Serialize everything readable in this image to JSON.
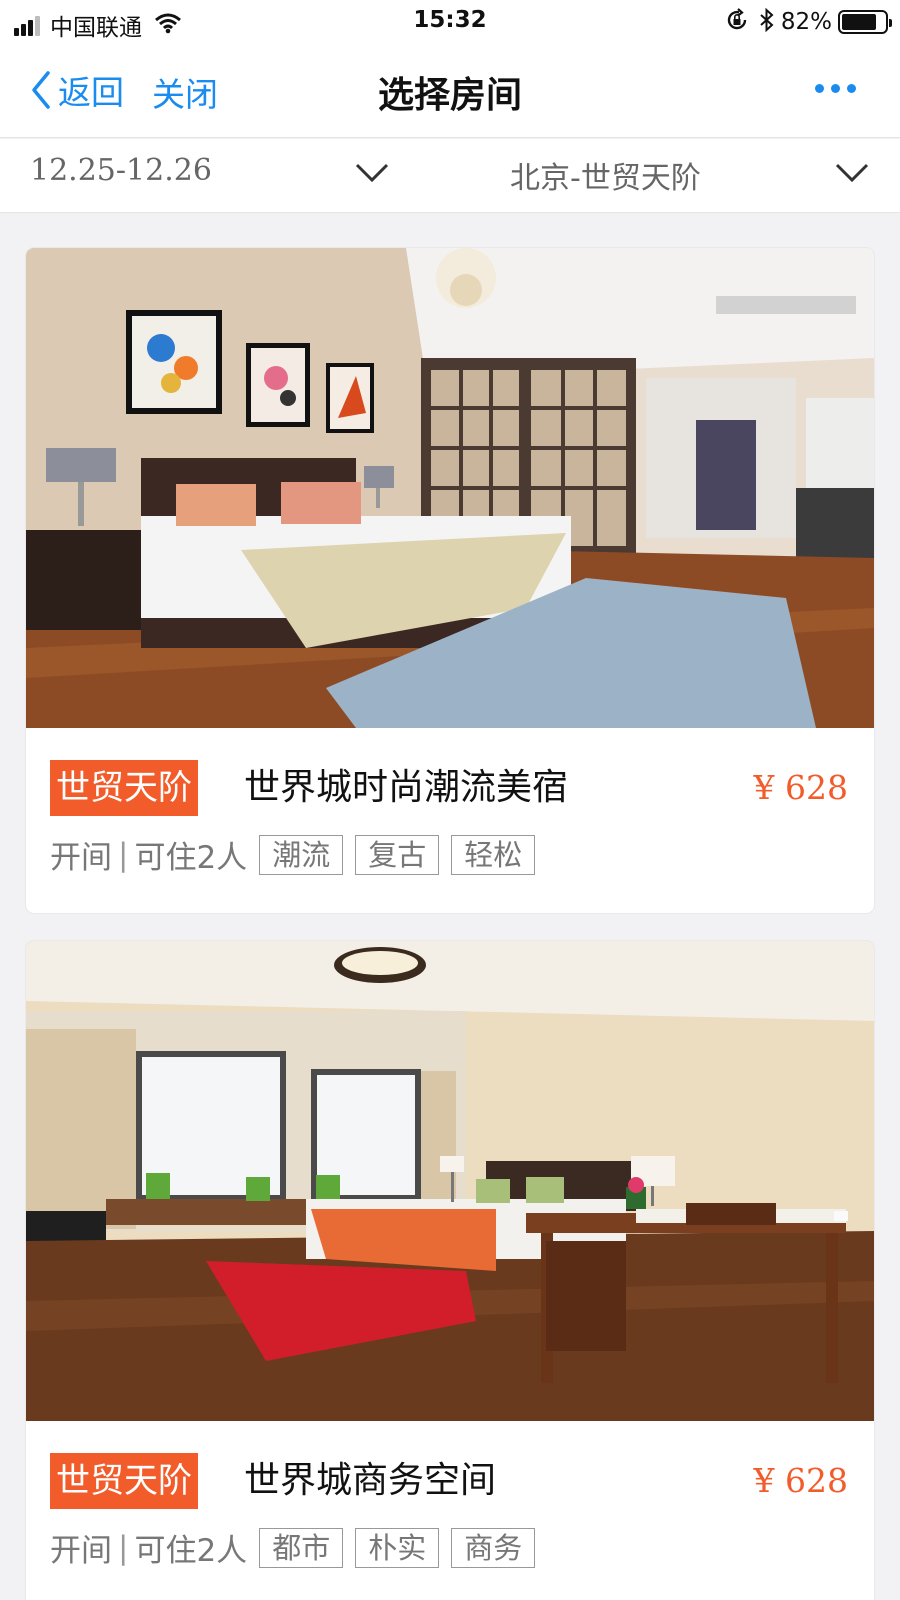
{
  "status_bar": {
    "carrier": "中国联通",
    "time": "15:32",
    "battery_percent": "82%",
    "battery_level": 0.82,
    "icons": [
      "signal-icon",
      "wifi-icon",
      "rotation-lock-icon",
      "bluetooth-icon",
      "battery-icon"
    ]
  },
  "nav": {
    "back_label": "返回",
    "close_label": "关闭",
    "title": "选择房间",
    "more_icon": "more-icon"
  },
  "filters": {
    "date_range": "12.25-12.26",
    "location": "北京-世贸天阶"
  },
  "rooms": [
    {
      "badge": "世贸天阶",
      "name": "世界城时尚潮流美宿",
      "price": "¥ 628",
      "meta_a": "开间",
      "separator": "|",
      "meta_b": "可住2人",
      "tags": [
        "潮流",
        "复古",
        "轻松"
      ],
      "photo": "bedroom-photo"
    },
    {
      "badge": "世贸天阶",
      "name": "世界城商务空间",
      "price": "¥ 628",
      "meta_a": "开间",
      "separator": "|",
      "meta_b": "可住2人",
      "tags": [
        "都市",
        "朴实",
        "商务"
      ],
      "photo": "bedroom-photo"
    }
  ],
  "colors": {
    "accent_blue": "#1a8cf0",
    "badge_orange": "#f25c2b",
    "price_orange": "#f25c2b"
  }
}
